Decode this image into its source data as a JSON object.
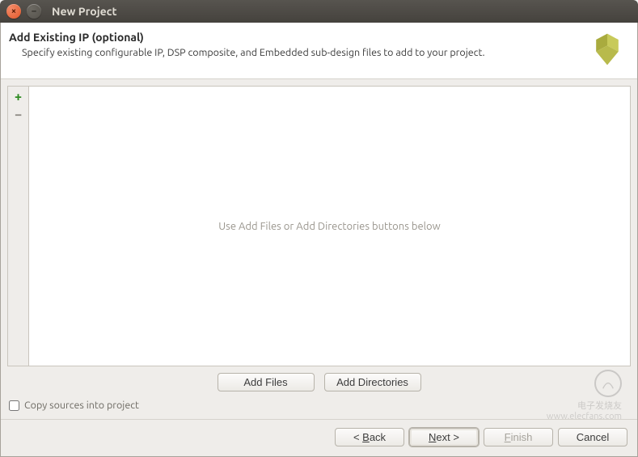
{
  "window": {
    "title": "New Project"
  },
  "header": {
    "heading": "Add Existing IP (optional)",
    "description": "Specify existing configurable IP, DSP composite, and Embedded sub-design files to add to your project."
  },
  "panel": {
    "placeholder": "Use Add Files or Add Directories buttons below"
  },
  "actions": {
    "add_files": "Add Files",
    "add_dirs": "Add Directories"
  },
  "options": {
    "copy_sources_label": "Copy sources into project",
    "copy_sources_checked": false
  },
  "footer": {
    "back": "< Back",
    "next": "Next >",
    "finish": "Finish",
    "cancel": "Cancel"
  }
}
